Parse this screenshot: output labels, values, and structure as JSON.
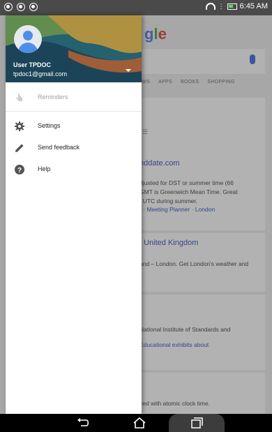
{
  "status_bar": {
    "time": "6:45 AM",
    "left_icons": [
      "notification-icon",
      "notification-icon",
      "notification-icon"
    ],
    "right_icons": [
      "wifi-icon",
      "vibrate-icon",
      "battery-icon"
    ]
  },
  "background_page": {
    "logo_partial": "gle",
    "tabs": [
      "IEWS",
      "APPS",
      "BOOKS",
      "SHOPPING"
    ],
    "result1_link": "nddate.com",
    "result1_text": [
      "djusted for DST or summer time (66",
      "GMT is Greenwich Mean Time. Great",
      "f UTC during summer."
    ],
    "result1_sublinks": "r · Meeting Planner · London",
    "result2_link": ", United Kingdom",
    "result2_text": "and – London. Get London's weather and",
    "result3_text": "National Institute of Standards and",
    "result3_sublink": "Educational exhibits about",
    "result4_text": "zed with atomic clock time."
  },
  "drawer": {
    "user_name": "User TPDOC",
    "user_email": "tpdoc1@gmail.com",
    "menu": [
      {
        "label": "Reminders",
        "icon": "hand-icon",
        "enabled": false
      },
      {
        "label": "Settings",
        "icon": "gear-icon",
        "enabled": true
      },
      {
        "label": "Send feedback",
        "icon": "pencil-icon",
        "enabled": true
      },
      {
        "label": "Help",
        "icon": "help-icon",
        "enabled": true
      }
    ]
  },
  "nav_bar": {
    "buttons": [
      "back-icon",
      "home-icon",
      "recents-icon"
    ]
  },
  "colors": {
    "status_bar": "#4a4a4a",
    "drawer_bg": "#ffffff",
    "scrim": "#a7a7a7",
    "avatar": "#4e8ee6",
    "link": "#34458e"
  }
}
